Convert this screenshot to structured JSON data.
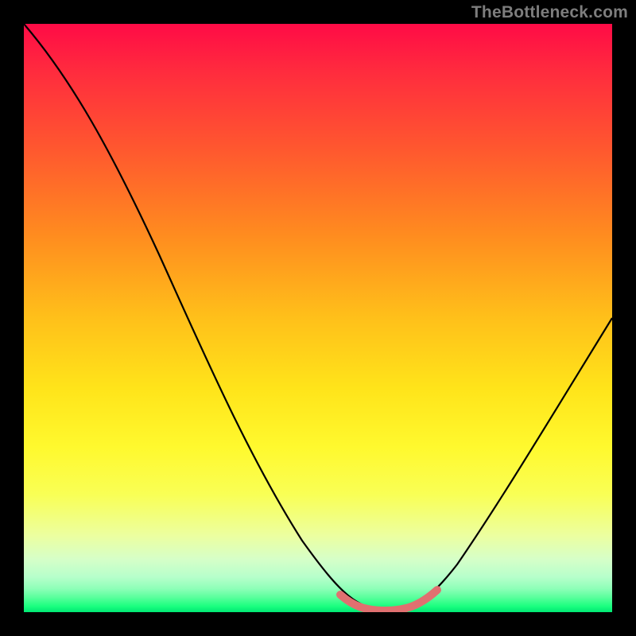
{
  "watermark": {
    "text": "TheBottleneck.com"
  },
  "palette": {
    "black": "#000000",
    "curve": "#000000",
    "highlight": "#e07070",
    "gradient_top": "#ff0b46",
    "gradient_bottom": "#00e874"
  },
  "chart_data": {
    "type": "line",
    "title": "",
    "xlabel": "",
    "ylabel": "",
    "xlim": [
      0,
      100
    ],
    "ylim": [
      0,
      100
    ],
    "grid": false,
    "legend": false,
    "series": [
      {
        "name": "bottleneck-curve",
        "x": [
          0,
          5,
          10,
          15,
          20,
          25,
          30,
          35,
          40,
          45,
          50,
          55,
          60,
          62,
          64,
          66,
          70,
          75,
          80,
          85,
          90,
          95,
          100
        ],
        "values": [
          100,
          95,
          89,
          82,
          74,
          66,
          57,
          47,
          37,
          27,
          18,
          10,
          4,
          2,
          1,
          1,
          2,
          6,
          13,
          22,
          32,
          43,
          55
        ]
      }
    ],
    "annotations": [
      {
        "name": "optimal-band",
        "x_range": [
          57,
          73
        ],
        "note": "pink highlight along curve at the minimum"
      }
    ]
  }
}
